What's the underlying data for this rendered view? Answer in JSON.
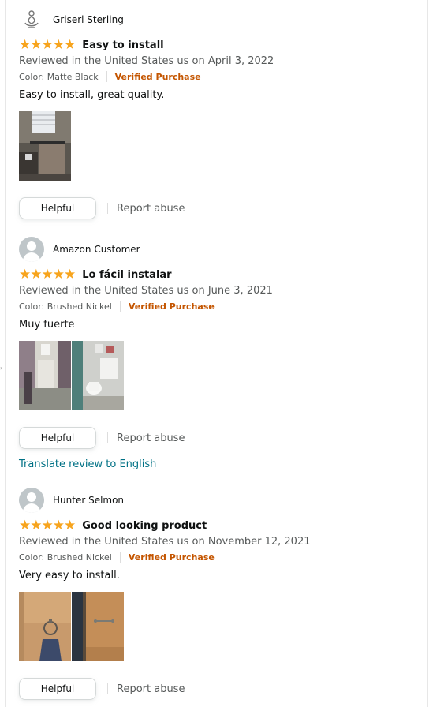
{
  "reviews": [
    {
      "reviewer": "Griserl Sterling",
      "avatar_icon": "lotus-avatar-icon",
      "stars": "★★★★★",
      "rating": 5,
      "title": "Easy to install",
      "date": "Reviewed in the United States us on April 3, 2022",
      "color": "Color: Matte Black",
      "verified": "Verified Purchase",
      "body": "Easy to install, great quality.",
      "helpful": "Helpful",
      "report": "Report abuse"
    },
    {
      "reviewer": "Amazon Customer",
      "avatar_icon": "default-avatar-icon",
      "stars": "★★★★★",
      "rating": 5,
      "title": "Lo fácil instalar",
      "date": "Reviewed in the United States us on June 3, 2021",
      "color": "Color: Brushed Nickel",
      "verified": "Verified Purchase",
      "body": "Muy fuerte",
      "helpful": "Helpful",
      "report": "Report abuse",
      "translate": "Translate review to English"
    },
    {
      "reviewer": "Hunter Selmon",
      "avatar_icon": "default-avatar-icon",
      "stars": "★★★★★",
      "rating": 5,
      "title": "Good looking product",
      "date": "Reviewed in the United States us on November 12, 2021",
      "color": "Color: Brushed Nickel",
      "verified": "Verified Purchase",
      "body": "Very easy to install.",
      "helpful": "Helpful",
      "report": "Report abuse"
    }
  ],
  "colors": {
    "star": "#f7a41d",
    "verified": "#c45500",
    "link": "#007185",
    "secondary_text": "#565959"
  }
}
